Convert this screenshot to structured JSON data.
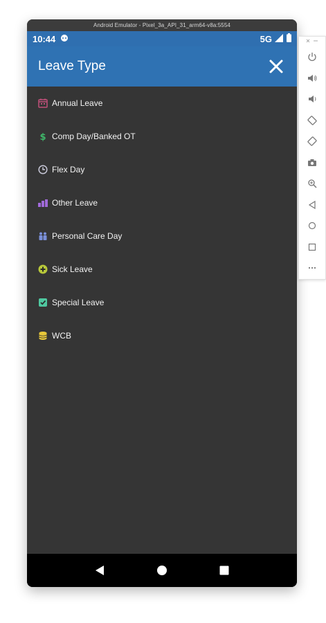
{
  "window": {
    "title": "Android Emulator - Pixel_3a_API_31_arm64-v8a:5554"
  },
  "status_bar": {
    "time": "10:44",
    "network": "5G"
  },
  "app_bar": {
    "title": "Leave Type"
  },
  "leave_types": [
    {
      "label": "Annual Leave",
      "icon": "calendar-icon",
      "color": "#c0507a"
    },
    {
      "label": "Comp Day/Banked OT",
      "icon": "dollar-icon",
      "color": "#3fb86a"
    },
    {
      "label": "Flex Day",
      "icon": "clock-icon",
      "color": "#c8c8d8"
    },
    {
      "label": "Other Leave",
      "icon": "blocks-icon",
      "color": "#a06ad8"
    },
    {
      "label": "Personal Care Day",
      "icon": "people-icon",
      "color": "#7a8fd8"
    },
    {
      "label": "Sick Leave",
      "icon": "plus-circle-icon",
      "color": "#b8c83a"
    },
    {
      "label": "Special Leave",
      "icon": "badge-icon",
      "color": "#4fc8a0"
    },
    {
      "label": "WCB",
      "icon": "coins-icon",
      "color": "#e8c83a"
    }
  ],
  "toolbar_icons": [
    "power-icon",
    "volume-up-icon",
    "volume-down-icon",
    "rotate-left-icon",
    "rotate-right-icon",
    "camera-icon",
    "zoom-icon",
    "back-icon",
    "home-icon",
    "overview-icon",
    "more-icon"
  ],
  "colors": {
    "app_bar": "#2f72b3",
    "background": "#353535"
  }
}
